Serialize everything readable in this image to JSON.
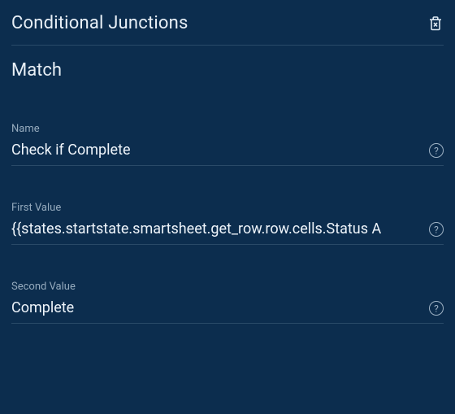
{
  "header": {
    "title": "Conditional Junctions"
  },
  "section": {
    "title": "Match"
  },
  "fields": {
    "name": {
      "label": "Name",
      "value": "Check if Complete"
    },
    "first_value": {
      "label": "First Value",
      "value": "{{states.startstate.smartsheet.get_row.row.cells.Status A"
    },
    "second_value": {
      "label": "Second Value",
      "value": "Complete"
    }
  },
  "help_glyph": "?"
}
